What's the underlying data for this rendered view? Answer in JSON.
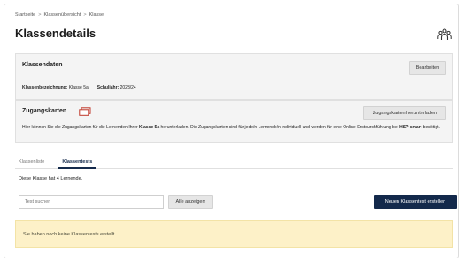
{
  "breadcrumb": [
    "Startseite",
    "Klassenübersicht",
    "Klasse"
  ],
  "page_title": "Klassendetails",
  "class_data": {
    "title": "Klassendaten",
    "edit_label": "Bearbeiten",
    "class_label": "Klassenbezeichnung:",
    "class_value": "Klasse 5a",
    "year_label": "Schuljahr:",
    "year_value": "2023/24"
  },
  "access_cards": {
    "title": "Zugangskarten",
    "download_label": "Zugangskarten herunterladen",
    "desc_1": "Hier können Sie die Zugangskarten für die Lernenden Ihrer ",
    "desc_class": "Klasse 5a",
    "desc_2": " herunterladen. Die Zugangskarten sind für jede/n Lernende/n individuell und werden für eine Online-Erstdurchführung bei ",
    "desc_brand": "HSP smart",
    "desc_3": " benötigt."
  },
  "tabs": [
    "Klassenliste",
    "Klassentests"
  ],
  "learners_text": "Diese Klasse hat 4 Lernende.",
  "search": {
    "placeholder": "Test suchen"
  },
  "show_all_label": "Alle anzeigen",
  "new_test_label": "Neuen Klassentest erstellen",
  "alert_text": "Sie haben noch keine Klassentests erstellt.",
  "colors": {
    "primary": "#13294b",
    "alert_bg": "#fdf1c8",
    "card_bg": "#f4f4f4"
  },
  "icons": [
    "group-icon",
    "card-icon"
  ]
}
